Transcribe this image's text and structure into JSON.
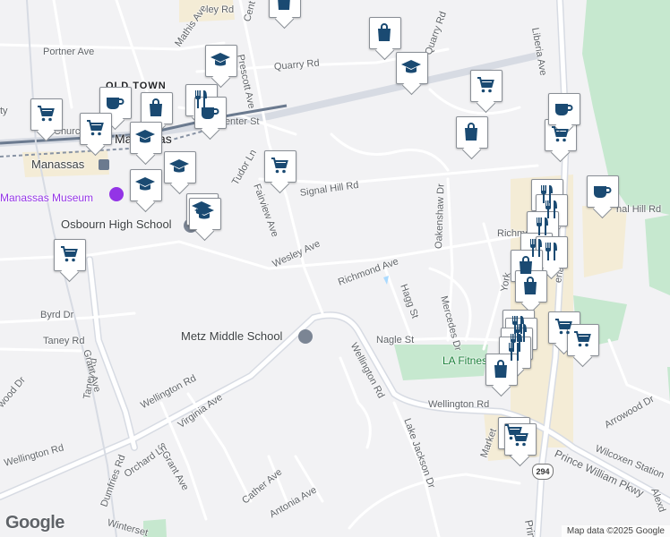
{
  "map": {
    "labels": {
      "dist_oldtown": "OLD TOWN",
      "manassas": "Manassas",
      "manassas_small": "Manassas",
      "manassas_museum": "Manassas Museum",
      "osbourn": "Osbourn High School",
      "metz": "Metz Middle School",
      "la_fitness": "LA Fitness",
      "portner": "Portner Ave",
      "mathis": "Mathis Ave",
      "quarry1": "Quarry Rd",
      "quarry2": "Quarry Rd",
      "prescott": "Prescott Ave",
      "center": "Center St",
      "church": "Church",
      "ley": "ley Rd",
      "cent": "Cent",
      "tudor": "Tudor Ln",
      "fairview": "Fairview Ave",
      "signal1": "Signal Hill Rd",
      "signal2": "nal Hill Rd",
      "oakenshaw": "Oakenshaw Dr",
      "wesley": "Wesley Ave",
      "richmond1": "Richmond Ave",
      "richmond2": "Richmo",
      "liberia1": "Liberia Ave",
      "liberia2": "eria Ave",
      "yorkshire": "York",
      "hagg": "Hagg St",
      "mercedes": "Mercedes Dr",
      "byrd": "Byrd Dr",
      "taney1": "Taney Rd",
      "taney2": "Taney Rd",
      "grant": "Grant Ave",
      "nagle": "Nagle St",
      "wellington1": "Wellington Rd",
      "wellington2": "Wellington Rd",
      "wellington3": "Wellington Rd",
      "wellington4": "Wellington Rd",
      "virginia": "Virginia Ave",
      "sgrant": "S Grant Ave",
      "orchard": "Orchard Ln",
      "lakejackson": "Lake Jackson Dr",
      "market": "Market",
      "arrowood1": "Arrowood Dr",
      "arrowood2": "wood Dr",
      "wilcoxen": "Wilcoxen Station",
      "pwpkwy": "Prince William Pkwy",
      "prince": "Prince",
      "cather": "Cather Ave",
      "antonia": "Antonia Ave",
      "dumfries": "Dumfries Rd",
      "winterset": "Winterset",
      "ty": "ty",
      "route": "294",
      "alexd": "Alexd"
    },
    "attribution": "Map data ©2025 Google",
    "logo": "Google",
    "colors": {
      "background": "#f2f2f4",
      "road": "#ffffff",
      "major_road": "#d7dbe3",
      "park": "#c6e8cf",
      "commercial": "#f4ecd6",
      "rail": "#6b7a8f",
      "marker_icon": "#1a4a72"
    },
    "markers": [
      {
        "type": "grocery",
        "icon": "shopping-cart-icon"
      },
      {
        "type": "shopping",
        "icon": "shopping-bag-icon"
      },
      {
        "type": "school",
        "icon": "graduation-cap-icon"
      },
      {
        "type": "cafe",
        "icon": "coffee-cup-icon"
      },
      {
        "type": "restaurant",
        "icon": "fork-knife-icon"
      }
    ]
  }
}
